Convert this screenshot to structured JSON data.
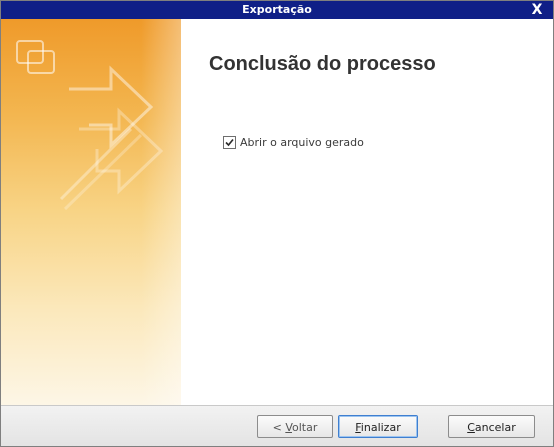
{
  "window": {
    "title": "Exportação",
    "close_label": "X"
  },
  "main": {
    "heading": "Conclusão do processo",
    "open_file_checkbox": {
      "label": "Abrir o arquivo gerado",
      "checked": true
    }
  },
  "footer": {
    "back_button": {
      "accel": "V",
      "before": "< ",
      "after": "oltar",
      "enabled": false
    },
    "finish_button": {
      "accel": "F",
      "before": "",
      "after": "inalizar",
      "default": true
    },
    "cancel_button": {
      "accel": "C",
      "before": "",
      "after": "ancelar"
    }
  },
  "colors": {
    "titlebar": "#0f1f87",
    "side_panel_top": "#ef9a2a",
    "side_panel_bottom": "#fdf6e6",
    "default_button_border": "#3f7fd0"
  },
  "icons": {
    "side_panel": "export-arrow-icon",
    "checkmark": "check-icon"
  }
}
